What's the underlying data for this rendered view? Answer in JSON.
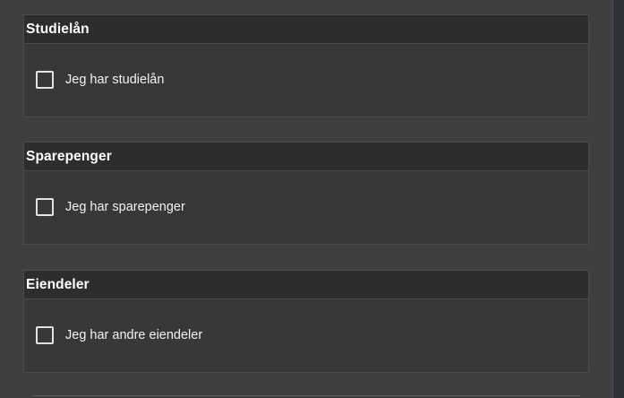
{
  "sections": [
    {
      "title": "Studielån",
      "checkbox_label": "Jeg har studielån",
      "checked": false
    },
    {
      "title": "Sparepenger",
      "checkbox_label": "Jeg har sparepenger",
      "checked": false
    },
    {
      "title": "Eiendeler",
      "checkbox_label": "Jeg har andre eiendeler",
      "checked": false
    }
  ],
  "colors": {
    "page_background": "#3f3f3f",
    "section_background": "#383838",
    "header_background": "#2d2d2d",
    "border": "#4b4b4b",
    "text": "#ffffff"
  }
}
